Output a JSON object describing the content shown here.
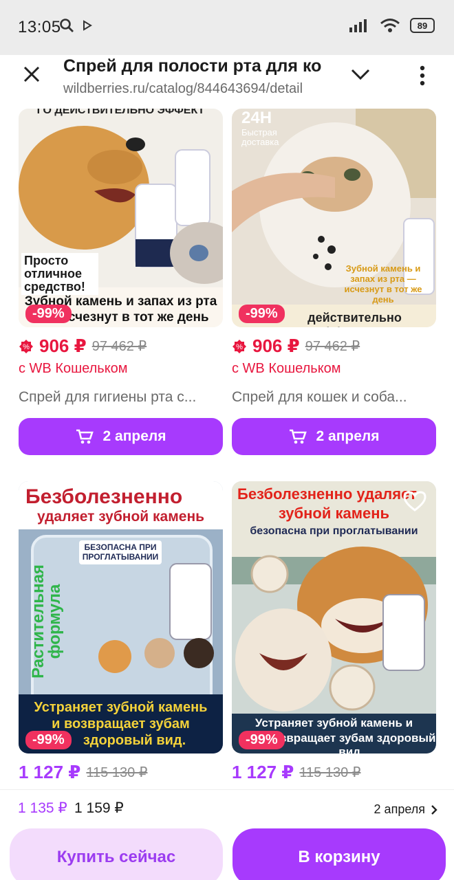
{
  "status": {
    "time": "13:05",
    "battery": "89"
  },
  "browser": {
    "title": "Спрей для полости рта для ко",
    "url": "wildberries.ru/catalog/844643694/detail"
  },
  "products": [
    {
      "image_texts": [
        "ГО ДЕЙСТВИТЕЛЬНО ЭФФЕКТ",
        "Просто отличное средство!",
        "Зубной камень и запах из рта",
        "исчезнут в тот же день"
      ],
      "discount": "-99%",
      "price": "906 ₽",
      "old_price": "97 462 ₽",
      "wallet": "с WB Кошельком",
      "name": "Спрей для гигиены рта с...",
      "cart_label": "2 апреля"
    },
    {
      "image_texts": [
        "24H",
        "Быстрая доставка",
        "Зубной камень и запах из рта — исчезнут в тот же день",
        "действительно эффективно"
      ],
      "discount": "-99%",
      "price": "906 ₽",
      "old_price": "97 462 ₽",
      "wallet": "с WB Кошельком",
      "name": "Спрей для кошек и соба...",
      "cart_label": "2 апреля"
    },
    {
      "image_texts": [
        "Безболезненно",
        "удаляет зубной камень",
        "БЕЗОПАСНА ПРИ ПРОГЛАТЫВАНИИ",
        "Растительная формула",
        "Устраняет зубной камень",
        "и возвращает зубам",
        "здоровый вид."
      ],
      "discount": "-99%",
      "price": "1 127 ₽",
      "old_price": "115 130 ₽"
    },
    {
      "image_texts": [
        "Безболезненно удаляет",
        "зубной камень",
        "безопасна при проглатывании",
        "Устраняет зубной камень и",
        "возвращает зубам здоровый вид."
      ],
      "discount": "-99%",
      "price": "1 127 ₽",
      "old_price": "115 130 ₽"
    }
  ],
  "bottom": {
    "price_wallet": "1 135 ₽",
    "price": "1 159 ₽",
    "date": "2 апреля",
    "buy_now": "Купить сейчас",
    "to_cart": "В корзину"
  },
  "colors": {
    "accent": "#a73afd",
    "price_red": "#e8173f",
    "discount_bg": "#f0315f"
  }
}
